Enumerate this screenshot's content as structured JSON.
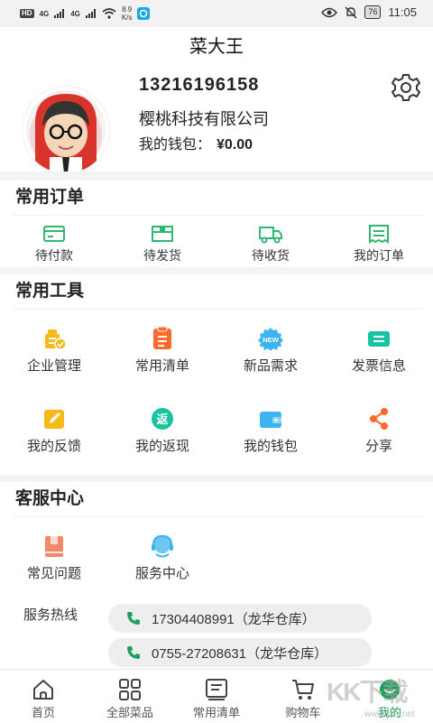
{
  "status_bar": {
    "net1": "HD",
    "sig1": "4G",
    "sig2": "4G",
    "speed_value": "8.9",
    "speed_unit": "K/s",
    "battery": "76",
    "time": "11:05"
  },
  "header": {
    "title": "菜大王"
  },
  "profile": {
    "phone": "13216196158",
    "company": "樱桃科技有限公司",
    "wallet_label": "我的钱包：",
    "wallet_amount": "¥0.00"
  },
  "orders": {
    "title": "常用订单",
    "items": [
      {
        "label": "待付款",
        "icon": "wallet-card-icon"
      },
      {
        "label": "待发货",
        "icon": "package-icon"
      },
      {
        "label": "待收货",
        "icon": "truck-icon"
      },
      {
        "label": "我的订单",
        "icon": "order-list-icon"
      }
    ]
  },
  "tools": {
    "title": "常用工具",
    "items": [
      {
        "label": "企业管理",
        "icon": "enterprise-icon"
      },
      {
        "label": "常用清单",
        "icon": "checklist-icon"
      },
      {
        "label": "新品需求",
        "icon": "new-badge-icon",
        "badge": "NEW"
      },
      {
        "label": "发票信息",
        "icon": "invoice-icon"
      },
      {
        "label": "我的反馈",
        "icon": "feedback-pen-icon"
      },
      {
        "label": "我的返现",
        "icon": "cashback-icon",
        "glyph": "返"
      },
      {
        "label": "我的钱包",
        "icon": "wallet-icon"
      },
      {
        "label": "分享",
        "icon": "share-icon"
      }
    ]
  },
  "service": {
    "title": "客服中心",
    "items": [
      {
        "label": "常见问题",
        "icon": "faq-book-icon"
      },
      {
        "label": "服务中心",
        "icon": "headset-icon"
      }
    ],
    "hotline_label": "服务热线",
    "hotlines": [
      {
        "text": "17304408991（龙华仓库）"
      },
      {
        "text": "0755-27208631（龙华仓库）"
      }
    ]
  },
  "tabbar": {
    "items": [
      {
        "label": "首页",
        "icon": "home-icon"
      },
      {
        "label": "全部菜品",
        "icon": "grid-icon"
      },
      {
        "label": "常用清单",
        "icon": "list-icon"
      },
      {
        "label": "购物车",
        "icon": "cart-icon"
      },
      {
        "label": "我的",
        "icon": "profile-icon",
        "active": true
      }
    ]
  },
  "watermark": {
    "text": "KK下载",
    "url": "www.kkx.net"
  },
  "colors": {
    "accent_green": "#1aa05a",
    "order_icon_green": "#2eb872",
    "tool_orange": "#ff6a2c",
    "tool_yellow": "#f6b91a",
    "tool_teal": "#17c3a0",
    "tool_blue": "#3cb4f0"
  }
}
